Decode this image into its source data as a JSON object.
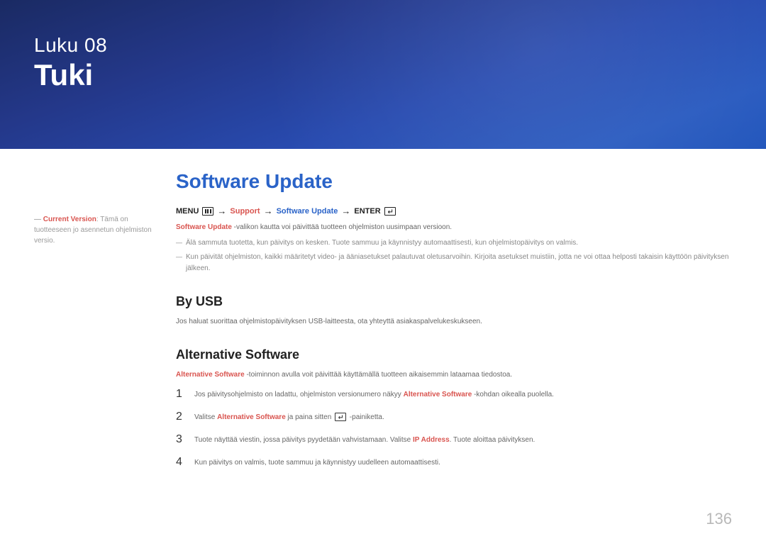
{
  "header": {
    "chapter_label": "Luku  08",
    "chapter_title": "Tuki"
  },
  "side_note": {
    "dash": "―",
    "version_label": "Current Version",
    "version_text": ": Tämä on tuotteeseen jo asennetun ohjelmiston versio."
  },
  "main": {
    "section_title": "Software Update",
    "breadcrumb": {
      "menu": "MENU",
      "support": "Support",
      "software_update": "Software Update",
      "enter": "ENTER"
    },
    "intro_prefix": "Software Update",
    "intro_rest": " -valikon kautta voi päivittää tuotteen ohjelmiston uusimpaan versioon.",
    "note1": "Älä sammuta tuotetta, kun päivitys on kesken. Tuote sammuu ja käynnistyy automaattisesti, kun ohjelmistopäivitys on valmis.",
    "note2": "Kun päivität ohjelmiston, kaikki määritetyt video- ja ääniasetukset palautuvat oletusarvoihin. Kirjoita asetukset muistiin, jotta ne voi ottaa helposti takaisin käyttöön päivityksen jälkeen.",
    "by_usb_title": "By USB",
    "by_usb_text": "Jos haluat suorittaa ohjelmistopäivityksen USB-laitteesta, ota yhteyttä asiakaspalvelukeskukseen.",
    "alt_sw_title": "Alternative Software",
    "alt_sw_prefix": "Alternative Software",
    "alt_sw_rest": " -toiminnon avulla voit päivittää käyttämällä tuotteen aikaisemmin lataamaa tiedostoa.",
    "steps": [
      {
        "num": "1",
        "pre": "Jos päivitysohjelmisto on ladattu, ohjelmiston versionumero näkyy ",
        "red": "Alternative Software",
        "post": " -kohdan oikealla puolella."
      },
      {
        "num": "2",
        "pre": "Valitse ",
        "red": "Alternative Software",
        "post_a": " ja paina sitten ",
        "post_b": " -painiketta."
      },
      {
        "num": "3",
        "pre": "Tuote näyttää viestin, jossa päivitys pyydetään vahvistamaan. Valitse ",
        "red": "IP Address",
        "post": ". Tuote aloittaa päivityksen."
      },
      {
        "num": "4",
        "pre": "Kun päivitys on valmis, tuote sammuu ja käynnistyy uudelleen automaattisesti.",
        "red": "",
        "post": ""
      }
    ]
  },
  "page_number": "136"
}
